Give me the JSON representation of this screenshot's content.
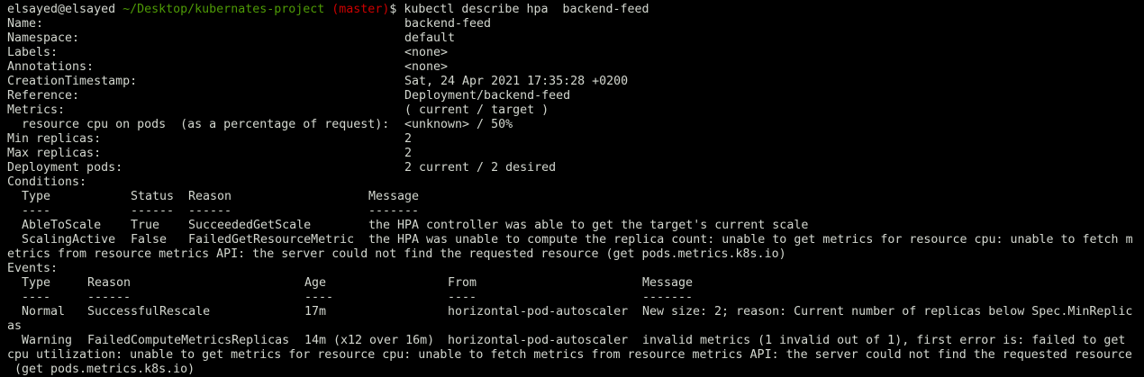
{
  "prompt": {
    "user_host": "elsayed@elsayed",
    "path": "~/Desktop/kubernates-project",
    "branch": "(master)",
    "symbol": "$",
    "command": "kubectl describe hpa  backend-feed"
  },
  "fields": [
    {
      "label": "Name:",
      "value": "backend-feed"
    },
    {
      "label": "Namespace:",
      "value": "default"
    },
    {
      "label": "Labels:",
      "value": "<none>"
    },
    {
      "label": "Annotations:",
      "value": "<none>"
    },
    {
      "label": "CreationTimestamp:",
      "value": "Sat, 24 Apr 2021 17:35:28 +0200"
    },
    {
      "label": "Reference:",
      "value": "Deployment/backend-feed"
    },
    {
      "label": "Metrics:",
      "value": "( current / target )"
    },
    {
      "label": "  resource cpu on pods  (as a percentage of request):",
      "value": "<unknown> / 50%"
    },
    {
      "label": "Min replicas:",
      "value": "2"
    },
    {
      "label": "Max replicas:",
      "value": "2"
    },
    {
      "label": "Deployment pods:",
      "value": "2 current / 2 desired"
    }
  ],
  "conditions": {
    "heading": "Conditions:",
    "headers": [
      "  Type",
      "Status",
      "Reason",
      "Message"
    ],
    "dashes": [
      "  ----",
      "------",
      "------",
      "-------"
    ],
    "rows": [
      [
        "  AbleToScale",
        "True",
        "SucceededGetScale",
        "the HPA controller was able to get the target's current scale"
      ],
      [
        "  ScalingActive",
        "False",
        "FailedGetResourceMetric",
        "the HPA was unable to compute the replica count: unable to get metrics for resource cpu: unable to fetch m"
      ]
    ],
    "wrap": "etrics from resource metrics API: the server could not find the requested resource (get pods.metrics.k8s.io)"
  },
  "events": {
    "heading": "Events:",
    "headers": [
      "  Type",
      "Reason",
      "Age",
      "From",
      "Message"
    ],
    "dashes": [
      "  ----",
      "------",
      "----",
      "----",
      "-------"
    ],
    "rows": [
      {
        "cols": [
          "  Normal",
          "SuccessfulRescale",
          "17m",
          "horizontal-pod-autoscaler",
          "New size: 2; reason: Current number of replicas below Spec.MinReplic"
        ],
        "wraps": [
          "as"
        ]
      },
      {
        "cols": [
          "  Warning",
          "FailedComputeMetricsReplicas",
          "14m (x12 over 16m)",
          "horizontal-pod-autoscaler",
          "invalid metrics (1 invalid out of 1), first error is: failed to get"
        ],
        "wraps": [
          "cpu utilization: unable to get metrics for resource cpu: unable to fetch metrics from resource metrics API: the server could not find the requested resource",
          " (get pods.metrics.k8s.io)"
        ]
      }
    ]
  },
  "colors": {
    "background": "#000000",
    "text": "#d3d7cf",
    "path": "#4e9a06",
    "branch": "#cc0000"
  }
}
